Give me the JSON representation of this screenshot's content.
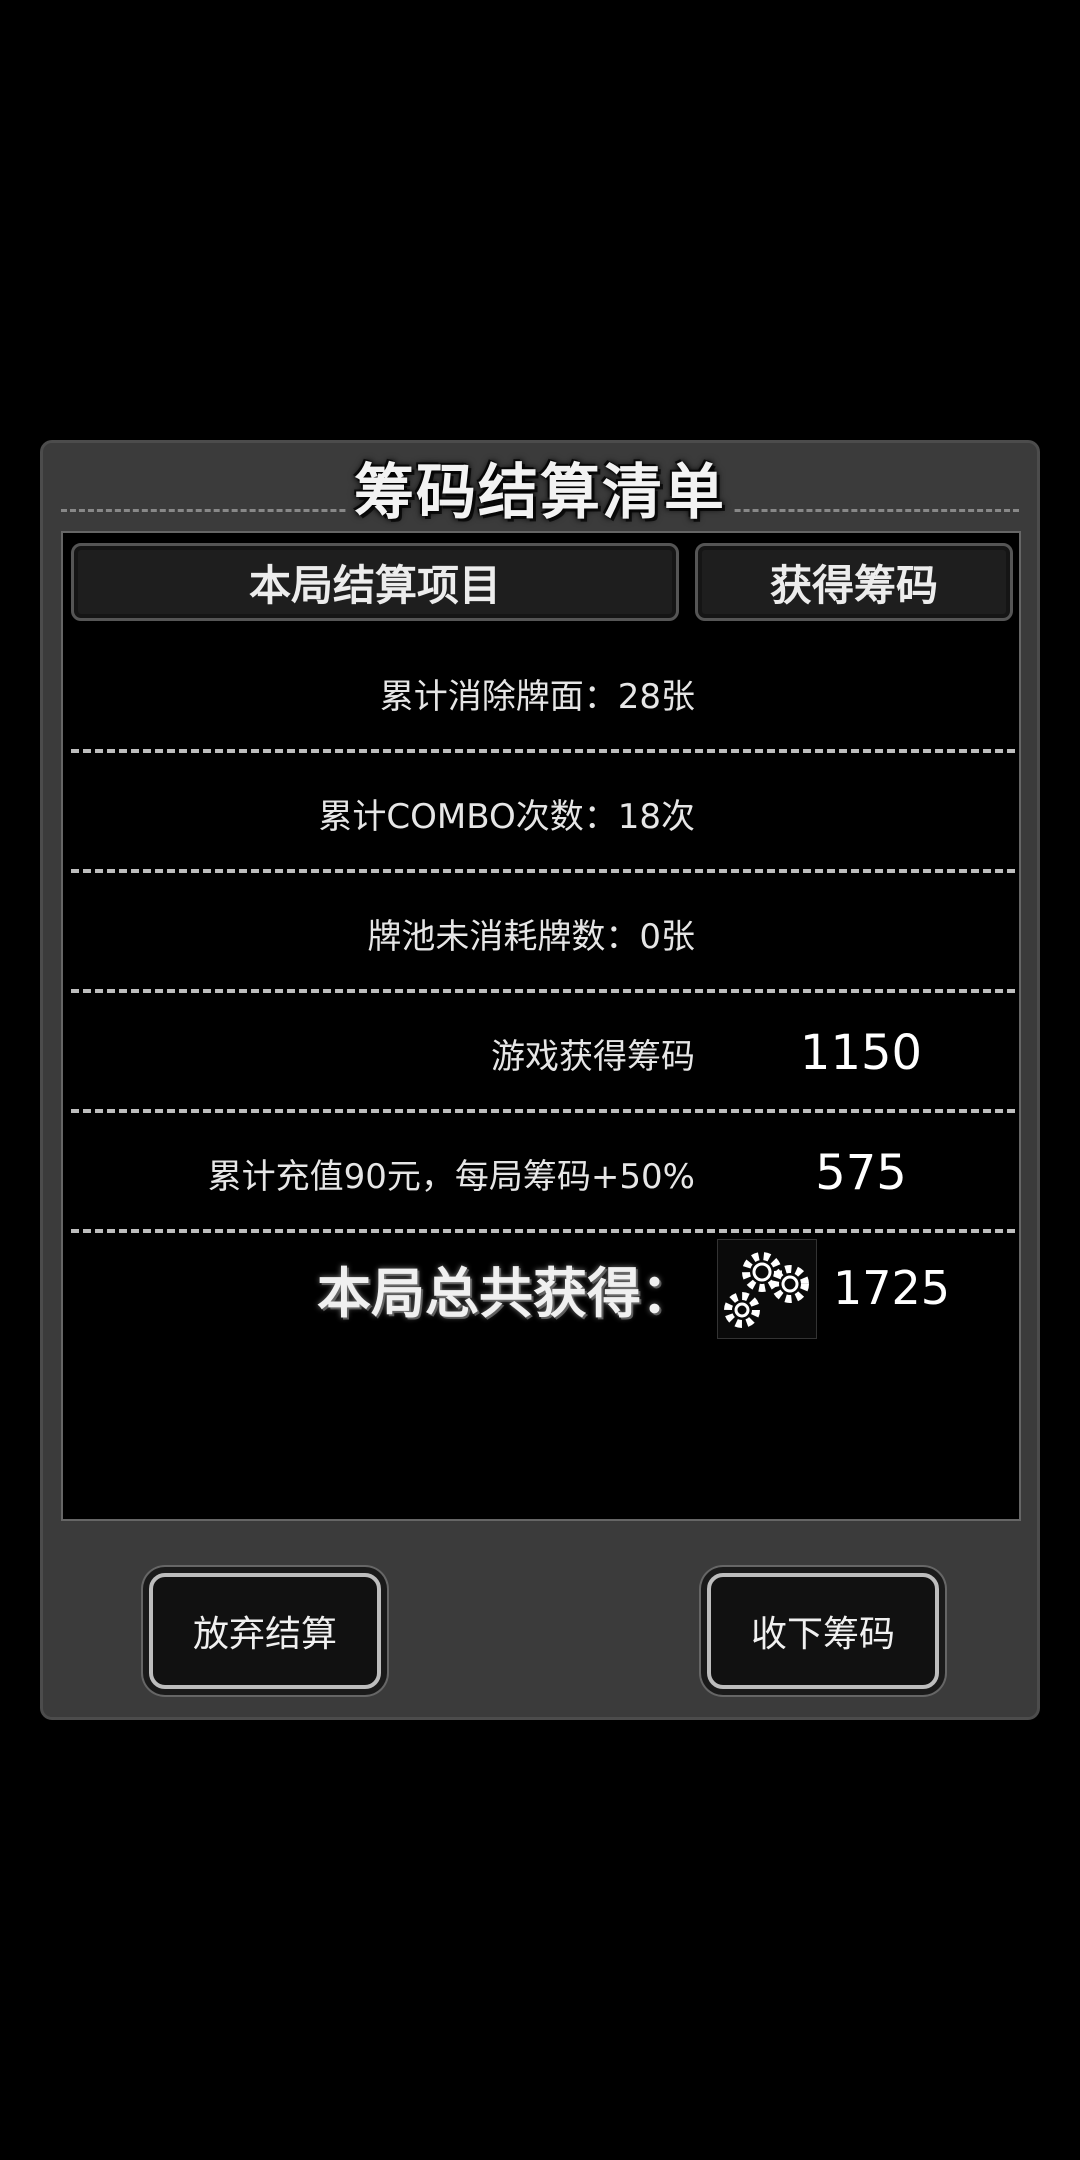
{
  "dialog": {
    "title": "筹码结算清单",
    "header": {
      "items_label": "本局结算项目",
      "chips_label": "获得筹码"
    },
    "rows": [
      {
        "label": "累计消除牌面：28张",
        "value": ""
      },
      {
        "label": "累计COMBO次数：18次",
        "value": ""
      },
      {
        "label": "牌池未消耗牌数：0张",
        "value": ""
      },
      {
        "label": "游戏获得筹码",
        "value": "1150"
      },
      {
        "label": "累计充值90元，每局筹码+50%",
        "value": "575"
      }
    ],
    "total": {
      "label": "本局总共获得：",
      "icon": "poker-chips-icon",
      "value": "1725"
    },
    "buttons": {
      "abandon": "放弃结算",
      "collect": "收下筹码"
    }
  },
  "colors": {
    "page_background": "#000000",
    "dialog_background": "#3b3b3b",
    "panel_background": "#000000",
    "header_cell_background": "#1e1e1e",
    "text": "#ffffff"
  }
}
